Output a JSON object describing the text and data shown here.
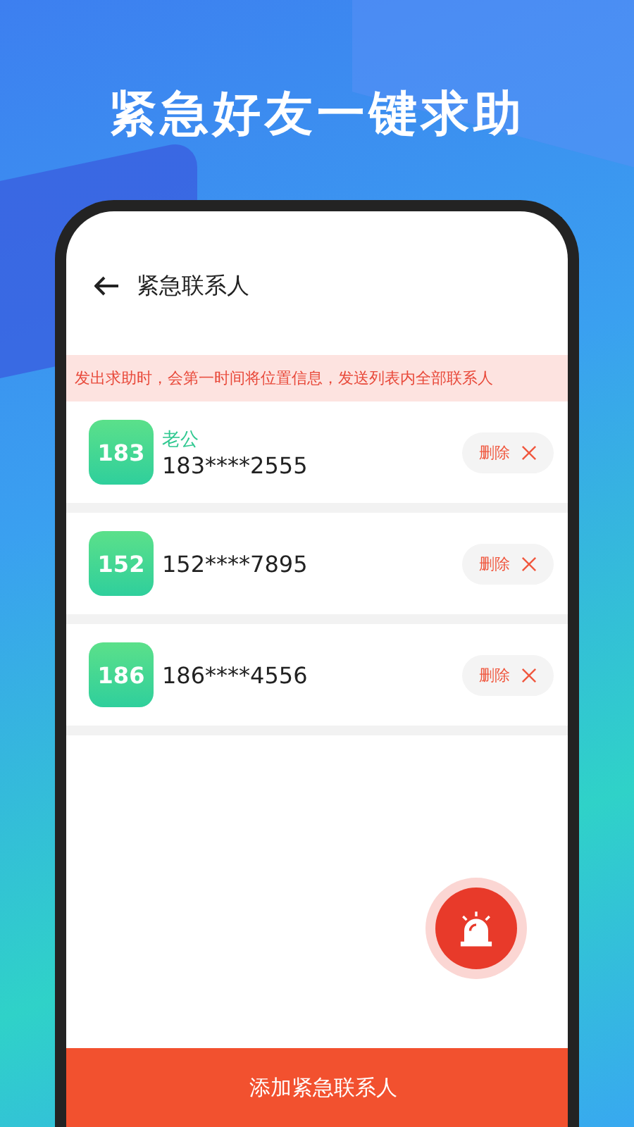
{
  "headline": "紧急好友一键求助",
  "screen": {
    "title": "紧急联系人",
    "notice": "发出求助时，会第一时间将位置信息，发送列表内全部联系人"
  },
  "contacts": [
    {
      "badge": "183",
      "name": "老公",
      "phone": "183****2555",
      "delete_label": "删除"
    },
    {
      "badge": "152",
      "phone": "152****7895",
      "delete_label": "删除"
    },
    {
      "badge": "186",
      "phone": "186****4556",
      "delete_label": "删除"
    }
  ],
  "add_button": "添加紧急联系人"
}
